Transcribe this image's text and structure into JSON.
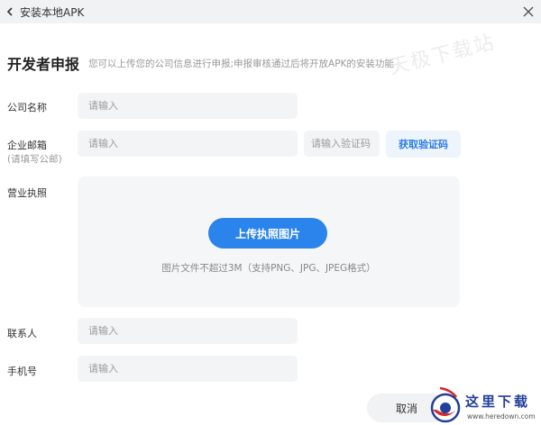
{
  "titlebar": {
    "title": "安装本地APK",
    "back_icon": "chevron-left-icon",
    "close_icon": "close-icon"
  },
  "header": {
    "title": "开发者申报",
    "description": "您可以上传您的公司信息进行申报;申报审核通过后将开放APK的安装功能",
    "watermark": "天极下载站"
  },
  "form": {
    "company": {
      "label": "公司名称",
      "placeholder": "请输入"
    },
    "email": {
      "label": "企业邮箱",
      "sublabel": "(请填写公邮)",
      "placeholder": "请输入",
      "code_placeholder": "请输入验证码",
      "code_button": "获取验证码"
    },
    "license": {
      "label": "营业执照",
      "upload_button": "上传执照图片",
      "hint": "图片文件不超过3M（支持PNG、JPG、JPEG格式）"
    },
    "contact": {
      "label": "联系人",
      "placeholder": "请输入"
    },
    "phone": {
      "label": "手机号",
      "placeholder": "请输入"
    }
  },
  "footer": {
    "cancel_button": "取消",
    "logo_text": "这里下载",
    "logo_url": "www.heredown.com"
  },
  "colors": {
    "accent": "#2b84ec",
    "link": "#2b7de9",
    "input_bg": "#f3f4f6",
    "titlebar_bg": "#f1f2f4"
  }
}
